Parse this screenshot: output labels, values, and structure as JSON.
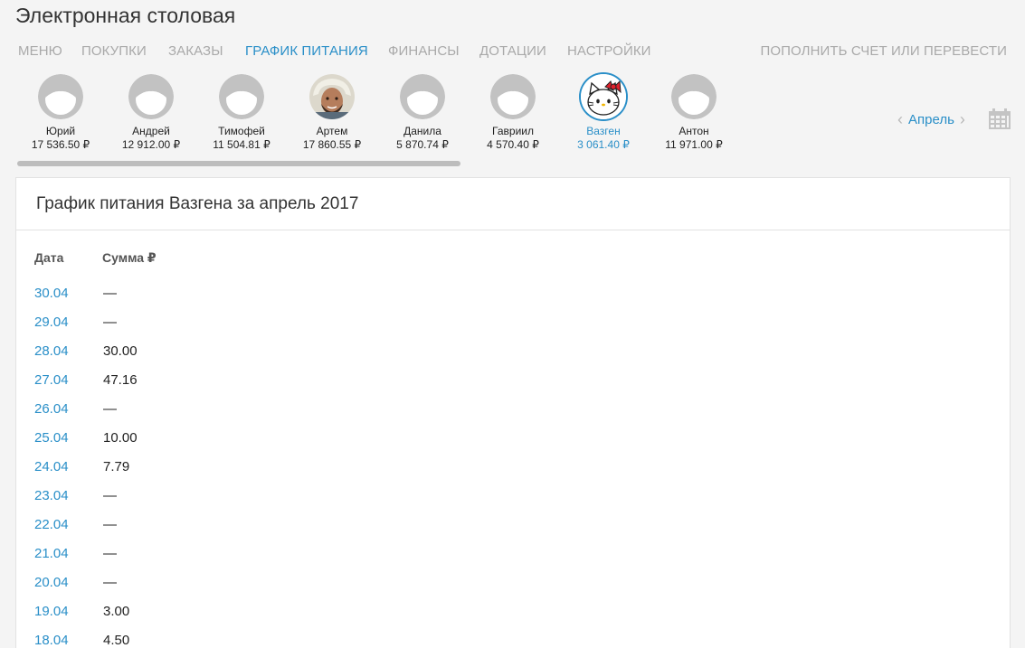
{
  "app": {
    "title": "Электронная столовая"
  },
  "nav": {
    "items": [
      {
        "label": "МЕНЮ",
        "active": false
      },
      {
        "label": "ПОКУПКИ",
        "active": false
      },
      {
        "label": "ЗАКАЗЫ",
        "active": false
      },
      {
        "label": "ГРАФИК ПИТАНИЯ",
        "active": true
      },
      {
        "label": "ФИНАНСЫ",
        "active": false
      },
      {
        "label": "ДОТАЦИИ",
        "active": false
      },
      {
        "label": "НАСТРОЙКИ",
        "active": false
      }
    ],
    "right_label": "ПОПОЛНИТЬ СЧЕТ ИЛИ ПЕРЕВЕСТИ"
  },
  "profiles": [
    {
      "name": "Юрий",
      "balance": "17 536.50 ₽",
      "avatar": "default-avatar-icon",
      "selected": false
    },
    {
      "name": "Андрей",
      "balance": "12 912.00 ₽",
      "avatar": "default-avatar-icon",
      "selected": false
    },
    {
      "name": "Тимофей",
      "balance": "11 504.81 ₽",
      "avatar": "default-avatar-icon",
      "selected": false
    },
    {
      "name": "Артем",
      "balance": "17 860.55 ₽",
      "avatar": "photo-avatar",
      "selected": false
    },
    {
      "name": "Данила",
      "balance": "5 870.74 ₽",
      "avatar": "default-avatar-icon",
      "selected": false
    },
    {
      "name": "Гавриил",
      "balance": "4 570.40 ₽",
      "avatar": "default-avatar-icon",
      "selected": false
    },
    {
      "name": "Вазген",
      "balance": "3 061.40 ₽",
      "avatar": "cat-bow-avatar",
      "selected": true
    },
    {
      "name": "Антон",
      "balance": "11 971.00 ₽",
      "avatar": "default-avatar-icon",
      "selected": false
    }
  ],
  "month": {
    "label": "Апрель",
    "prev_icon": "chevron-left-icon",
    "next_icon": "chevron-right-icon",
    "calendar_icon": "calendar-icon"
  },
  "card": {
    "title": "График питания Вазгена за апрель 2017",
    "columns": {
      "date": "Дата",
      "sum": "Сумма ₽"
    },
    "rows": [
      {
        "date": "30.04",
        "sum": "—"
      },
      {
        "date": "29.04",
        "sum": "—"
      },
      {
        "date": "28.04",
        "sum": "30.00"
      },
      {
        "date": "27.04",
        "sum": "47.16"
      },
      {
        "date": "26.04",
        "sum": "—"
      },
      {
        "date": "25.04",
        "sum": "10.00"
      },
      {
        "date": "24.04",
        "sum": "7.79"
      },
      {
        "date": "23.04",
        "sum": "—"
      },
      {
        "date": "22.04",
        "sum": "—"
      },
      {
        "date": "21.04",
        "sum": "—"
      },
      {
        "date": "20.04",
        "sum": "—"
      },
      {
        "date": "19.04",
        "sum": "3.00"
      },
      {
        "date": "18.04",
        "sum": "4.50"
      }
    ]
  },
  "colors": {
    "accent": "#2a8fc8",
    "nav_inactive": "#a9a9a9",
    "avatar_gray": "#c2c2c2"
  }
}
